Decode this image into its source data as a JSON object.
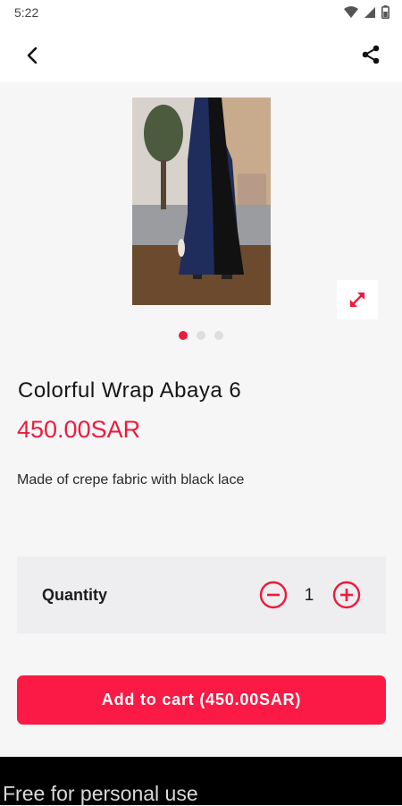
{
  "status_bar": {
    "time": "5:22"
  },
  "product": {
    "title": "Colorful Wrap Abaya 6",
    "price": "450.00SAR",
    "description": "Made of crepe fabric with black lace",
    "image_count": 3,
    "active_image_index": 0
  },
  "quantity": {
    "label": "Quantity",
    "value": "1"
  },
  "cart": {
    "button_label": "Add to cart (450.00SAR)"
  },
  "footer": {
    "text": "Free for personal use"
  },
  "colors": {
    "accent": "#ee1b3c",
    "button": "#fa1a45",
    "page_bg": "#f7f6f7",
    "quantity_bg": "#eeedf0"
  },
  "icons": {
    "back": "arrow-left-icon",
    "share": "share-icon",
    "expand": "expand-icon",
    "minus": "minus-circle-icon",
    "plus": "plus-circle-icon"
  }
}
